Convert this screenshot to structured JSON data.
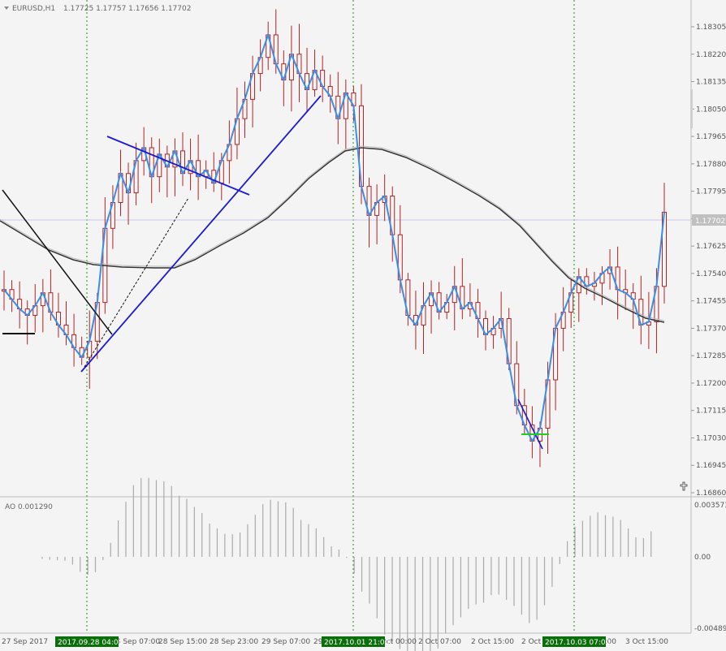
{
  "header": {
    "symbol": "EURUSD,H1",
    "ohlc": "1.17725 1.17757 1.17656 1.17702"
  },
  "price_tag": "1.17702",
  "ao_label": "AO 0.001290",
  "date_markers": [
    "2017.09.28 04:00",
    "2017.10.01 21:00",
    "2017.10.03 07:00"
  ],
  "colors": {
    "bull": "#b22222",
    "bear": "#b22222",
    "ma_fast": "#3a8ee6",
    "ma_slow": "#333333",
    "trend_blue": "#1a1ad0",
    "ao_bar": "#aaaaaa",
    "marker_green": "#0a6e0a"
  },
  "chart_data": {
    "type": "line",
    "price_axis_ticks": [
      "1.18305",
      "1.18220",
      "1.18135",
      "1.18050",
      "1.17965",
      "1.17880",
      "1.17795",
      "1.17710",
      "1.17625",
      "1.17540",
      "1.17455",
      "1.17370",
      "1.17285",
      "1.17200",
      "1.17115",
      "1.17030",
      "1.16945",
      "1.16860"
    ],
    "ao_axis_ticks": [
      "0.003573",
      "0.00",
      "-0.004894"
    ],
    "time_axis_labels": [
      "27 Sep 2017",
      "28 Sep 07:00",
      "28 Sep 15:00",
      "28 Sep 23:00",
      "29 Sep 07:00",
      "29 Sep 15:00",
      "2 Oct 00:00",
      "2 Oct 07:00",
      "2 Oct 15:00",
      "2 Oct 23:00",
      "3 Oct 07:00",
      "3 Oct 15:00"
    ],
    "close_series": [
      1.1749,
      1.1746,
      1.1743,
      1.1741,
      1.1744,
      1.1748,
      1.1742,
      1.1738,
      1.1735,
      1.1731,
      1.1728,
      1.1733,
      1.1745,
      1.1768,
      1.1776,
      1.1785,
      1.1779,
      1.1789,
      1.1793,
      1.1784,
      1.1791,
      1.1787,
      1.1792,
      1.1785,
      1.1789,
      1.1784,
      1.1786,
      1.1782,
      1.1789,
      1.1794,
      1.1802,
      1.1808,
      1.1816,
      1.1821,
      1.1828,
      1.1819,
      1.1814,
      1.1822,
      1.1816,
      1.1811,
      1.1817,
      1.1812,
      1.1809,
      1.1802,
      1.181,
      1.1806,
      1.1781,
      1.1772,
      1.1776,
      1.1778,
      1.1766,
      1.1752,
      1.1741,
      1.1738,
      1.1744,
      1.1748,
      1.1742,
      1.1745,
      1.175,
      1.1743,
      1.1745,
      1.174,
      1.1735,
      1.1737,
      1.174,
      1.1726,
      1.1713,
      1.1707,
      1.1702,
      1.1706,
      1.1721,
      1.1737,
      1.1742,
      1.1748,
      1.1753,
      1.175,
      1.1751,
      1.1754,
      1.1756,
      1.1749,
      1.1748,
      1.1746,
      1.1738,
      1.1739,
      1.175,
      1.1773
    ],
    "annotations": [
      "trend lines",
      "moving averages",
      "Awesome Oscillator"
    ]
  }
}
